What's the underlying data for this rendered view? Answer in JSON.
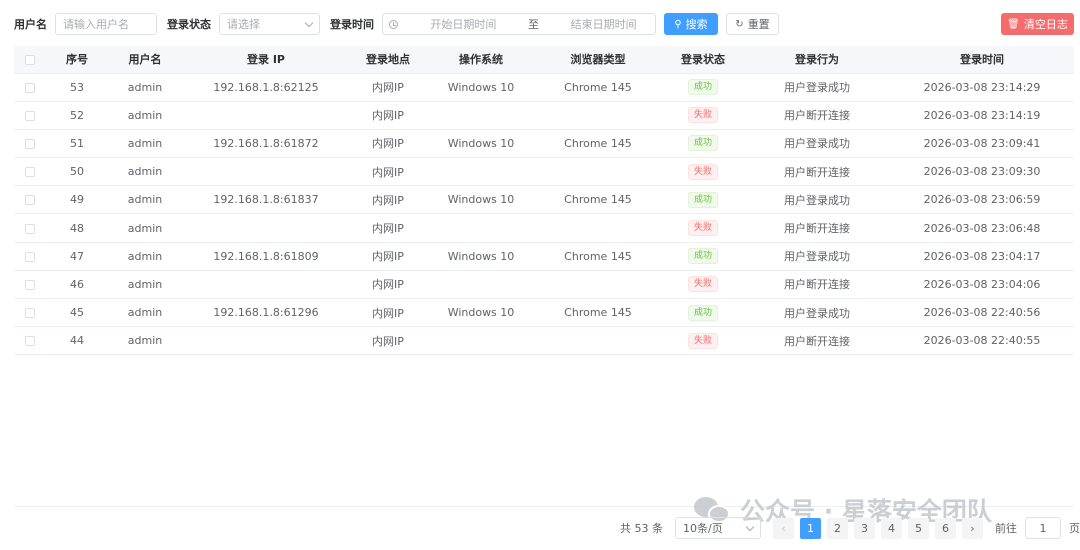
{
  "filters": {
    "username_label": "用户名",
    "username_placeholder": "请输入用户名",
    "status_label": "登录状态",
    "status_placeholder": "请选择",
    "time_label": "登录时间",
    "date_start_placeholder": "开始日期时间",
    "date_separator": "至",
    "date_end_placeholder": "结束日期时间",
    "search_label": "搜索",
    "reset_label": "重置",
    "clear_label": "清空日志"
  },
  "table": {
    "headers": [
      "序号",
      "用户名",
      "登录 IP",
      "登录地点",
      "操作系统",
      "浏览器类型",
      "登录状态",
      "登录行为",
      "登录时间"
    ],
    "rows": [
      {
        "id": "53",
        "user": "admin",
        "ip": "192.168.1.8:62125",
        "location": "内网IP",
        "os": "Windows 10",
        "browser": "Chrome 145",
        "status": "成功",
        "status_type": "success",
        "action": "用户登录成功",
        "time": "2026-03-08 23:14:29"
      },
      {
        "id": "52",
        "user": "admin",
        "ip": "",
        "location": "内网IP",
        "os": "",
        "browser": "",
        "status": "失败",
        "status_type": "fail",
        "action": "用户断开连接",
        "time": "2026-03-08 23:14:19"
      },
      {
        "id": "51",
        "user": "admin",
        "ip": "192.168.1.8:61872",
        "location": "内网IP",
        "os": "Windows 10",
        "browser": "Chrome 145",
        "status": "成功",
        "status_type": "success",
        "action": "用户登录成功",
        "time": "2026-03-08 23:09:41"
      },
      {
        "id": "50",
        "user": "admin",
        "ip": "",
        "location": "内网IP",
        "os": "",
        "browser": "",
        "status": "失败",
        "status_type": "fail",
        "action": "用户断开连接",
        "time": "2026-03-08 23:09:30"
      },
      {
        "id": "49",
        "user": "admin",
        "ip": "192.168.1.8:61837",
        "location": "内网IP",
        "os": "Windows 10",
        "browser": "Chrome 145",
        "status": "成功",
        "status_type": "success",
        "action": "用户登录成功",
        "time": "2026-03-08 23:06:59"
      },
      {
        "id": "48",
        "user": "admin",
        "ip": "",
        "location": "内网IP",
        "os": "",
        "browser": "",
        "status": "失败",
        "status_type": "fail",
        "action": "用户断开连接",
        "time": "2026-03-08 23:06:48"
      },
      {
        "id": "47",
        "user": "admin",
        "ip": "192.168.1.8:61809",
        "location": "内网IP",
        "os": "Windows 10",
        "browser": "Chrome 145",
        "status": "成功",
        "status_type": "success",
        "action": "用户登录成功",
        "time": "2026-03-08 23:04:17"
      },
      {
        "id": "46",
        "user": "admin",
        "ip": "",
        "location": "内网IP",
        "os": "",
        "browser": "",
        "status": "失败",
        "status_type": "fail",
        "action": "用户断开连接",
        "time": "2026-03-08 23:04:06"
      },
      {
        "id": "45",
        "user": "admin",
        "ip": "192.168.1.8:61296",
        "location": "内网IP",
        "os": "Windows 10",
        "browser": "Chrome 145",
        "status": "成功",
        "status_type": "success",
        "action": "用户登录成功",
        "time": "2026-03-08 22:40:56"
      },
      {
        "id": "44",
        "user": "admin",
        "ip": "",
        "location": "内网IP",
        "os": "",
        "browser": "",
        "status": "失败",
        "status_type": "fail",
        "action": "用户断开连接",
        "time": "2026-03-08 22:40:55"
      }
    ]
  },
  "pagination": {
    "total_text": "共 53 条",
    "page_size": "10条/页",
    "pages": [
      "1",
      "2",
      "3",
      "4",
      "5",
      "6"
    ],
    "current_page": "1",
    "goto_prefix": "前往",
    "goto_value": "1",
    "goto_suffix": "页"
  },
  "watermark": {
    "text": "公众号 · 星落安全团队"
  },
  "colors": {
    "primary": "#409eff",
    "danger": "#f56c6c",
    "success": "#67c23a"
  }
}
